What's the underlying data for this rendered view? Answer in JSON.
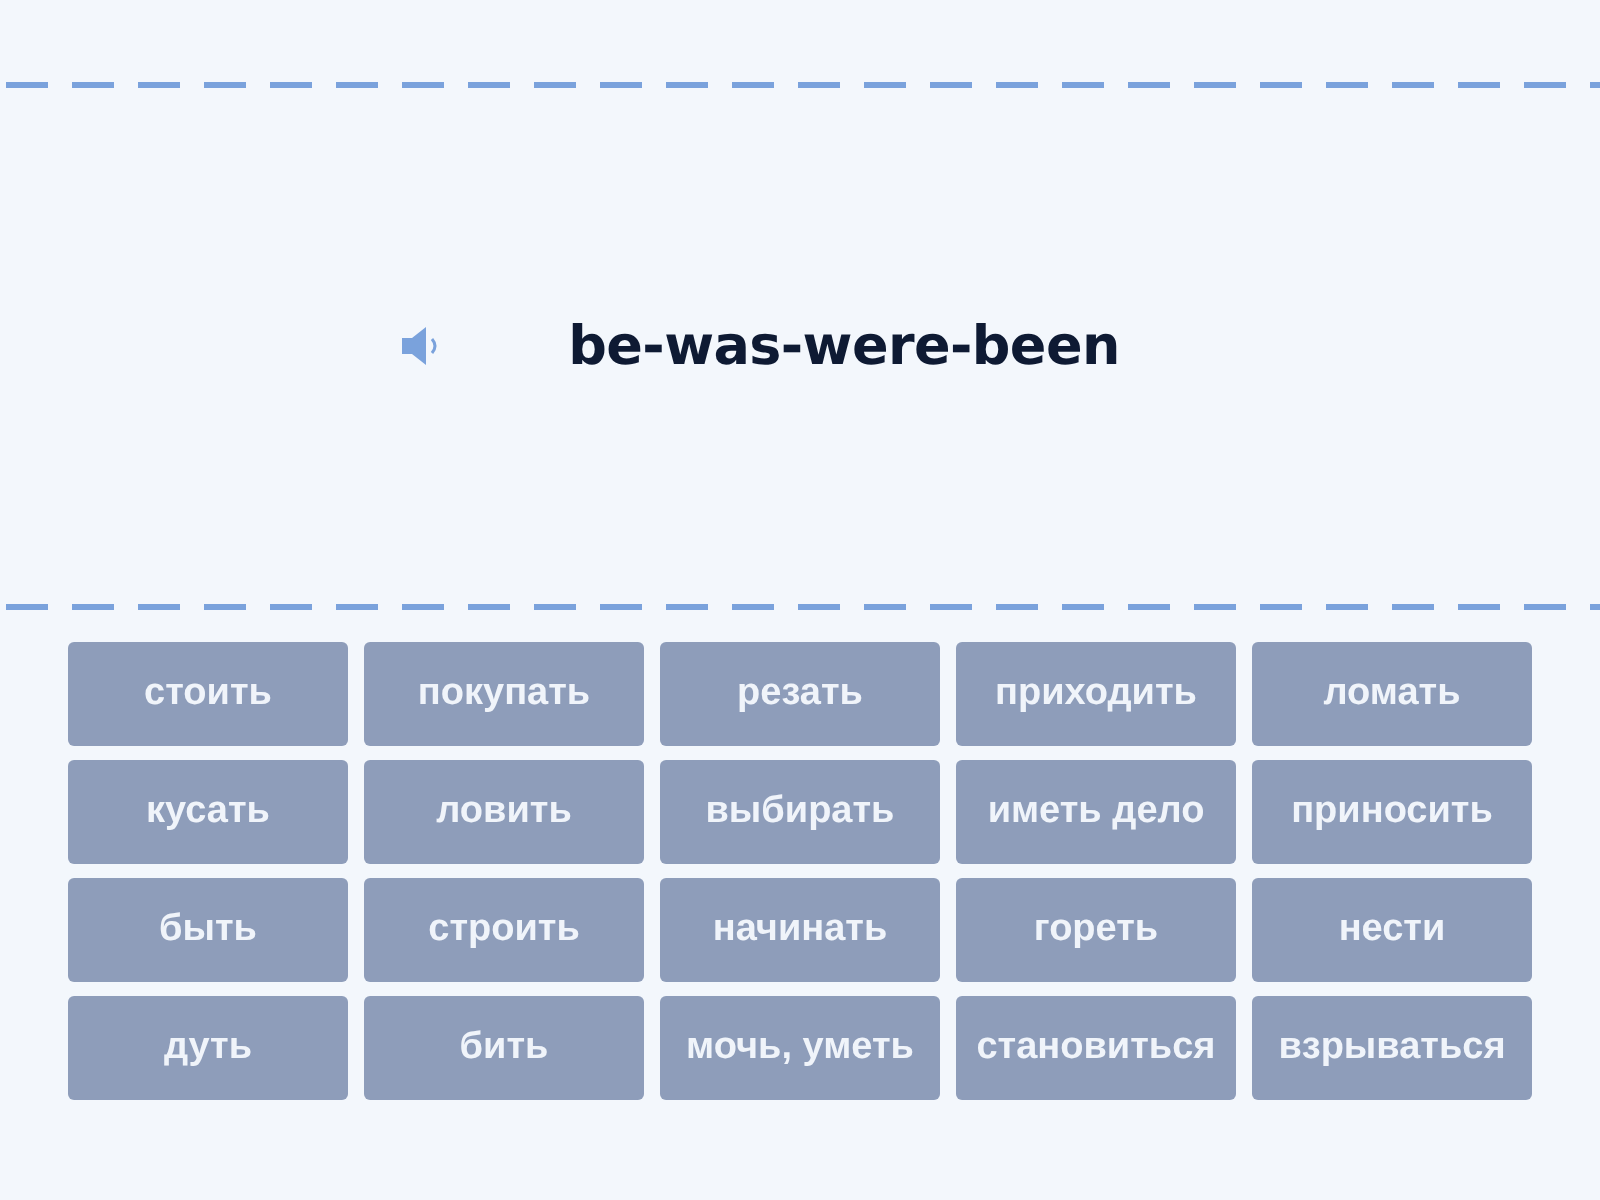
{
  "prompt": {
    "text": "be-was-were-been"
  },
  "tiles": [
    "стоить",
    "покупать",
    "резать",
    "приходить",
    "ломать",
    "кусать",
    "ловить",
    "выбирать",
    "иметь дело",
    "приносить",
    "быть",
    "строить",
    "начинать",
    "гореть",
    "нести",
    "дуть",
    "бить",
    "мочь, уметь",
    "становиться",
    "взрываться"
  ]
}
